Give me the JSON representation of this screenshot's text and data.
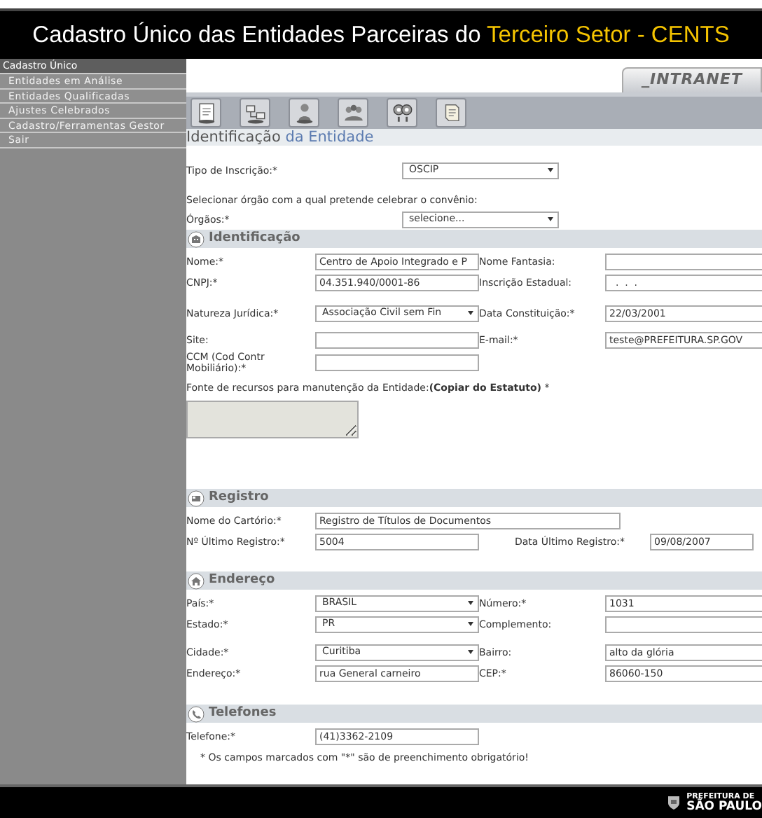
{
  "header": {
    "title": "Cadastro Único das Entidades Parceiras do",
    "title_highlight": "Terceiro Setor - CENTS"
  },
  "sidebar": {
    "heading": "Cadastro Único",
    "items": [
      "Entidades em Análise",
      "Entidades Qualificadas",
      "Ajustes Celebrados",
      "Cadastro/Ferramentas Gestor",
      "Sair"
    ]
  },
  "intranet_tab": "_INTRANET",
  "page_title": {
    "text": "Identificação",
    "highlight": "da Entidade"
  },
  "top_fields": [
    {
      "kind": "select",
      "label": "Tipo de Inscrição:*",
      "value": "OSCIP"
    },
    {
      "kind": "note",
      "text": "Selecionar órgão com a qual pretende celebrar o convênio:"
    },
    {
      "kind": "select",
      "label": "Órgãos:*",
      "value": "selecione..."
    }
  ],
  "sections": [
    {
      "kind": "identity",
      "title": "Identificação",
      "rows": [
        {
          "fields": [
            {
              "kind": "text",
              "label": "Nome:*",
              "value": "Centro de Apoio Integrado e P"
            },
            {
              "kind": "text",
              "label": "Nome Fantasia:"
            }
          ]
        },
        {
          "fields": [
            {
              "kind": "text",
              "label": "CNPJ:*",
              "value": "04.351.940/0001-86"
            },
            {
              "kind": "text",
              "label": "Inscrição Estadual:",
              "value": "  .  .  ."
            }
          ]
        },
        {
          "fields": [
            {
              "kind": "select",
              "label": "Natureza Jurídica:*",
              "value": "Associação Civil sem Fin"
            },
            {
              "kind": "text",
              "label": "Data Constituição:*",
              "value": "22/03/2001"
            }
          ]
        },
        {
          "fields": [
            {
              "kind": "text",
              "label": "Site:"
            },
            {
              "kind": "text",
              "label": "E-mail:*",
              "value": "teste@PREFEITURA.SP.GOV"
            }
          ]
        },
        {
          "fields": [
            {
              "kind": "text",
              "label": "CCM (Cod Contr Mobiliário):*"
            }
          ]
        },
        {
          "fields": [
            {
              "kind": "textarea",
              "label": "Fonte de recursos para manutenção da Entidade:**(Copiar do Estatuto)** *",
              "disabled": true
            }
          ]
        }
      ]
    },
    {
      "kind": "registry",
      "title": "Registro",
      "rows": [
        {
          "fields": [
            {
              "kind": "text",
              "label": "Nome do Cartório:*",
              "value": "Registro de Títulos de Documentos"
            }
          ]
        },
        {
          "fields": [
            {
              "kind": "text",
              "label": "Nº Último Registro:*",
              "value": "5004"
            },
            {
              "kind": "text",
              "label": "Data Último Registro:*",
              "value": "09/08/2007"
            }
          ]
        }
      ]
    },
    {
      "kind": "address",
      "title": "Endereço",
      "rows": [
        {
          "fields": [
            {
              "kind": "select",
              "label": "País:*",
              "value": "BRASIL"
            },
            {
              "kind": "text",
              "label": "Número:*",
              "value": "1031"
            }
          ]
        },
        {
          "fields": [
            {
              "kind": "select",
              "label": "Estado:*",
              "value": "PR"
            },
            {
              "kind": "text",
              "label": "Complemento:"
            }
          ]
        },
        {
          "fields": [
            {
              "kind": "select",
              "label": "Cidade:*",
              "value": "Curitiba"
            },
            {
              "kind": "text",
              "label": "Bairro:",
              "value": "alto da glória"
            }
          ]
        },
        {
          "fields": [
            {
              "kind": "text",
              "label": "Endereço:*",
              "value": "rua General carneiro"
            },
            {
              "kind": "text",
              "label": "CEP:*",
              "value": "86060-150"
            }
          ]
        }
      ]
    },
    {
      "kind": "phone",
      "title": "Telefones",
      "rows": [
        {
          "fields": [
            {
              "kind": "text",
              "label": "Telefone:*",
              "value": "(41)3362-2109"
            }
          ]
        }
      ]
    }
  ],
  "footnote": "* Os campos marcados com \"*\" são de preenchimento obrigatório!",
  "footer": {
    "line1": "PREFEITURA DE",
    "line2": "SÃO PAULO"
  }
}
